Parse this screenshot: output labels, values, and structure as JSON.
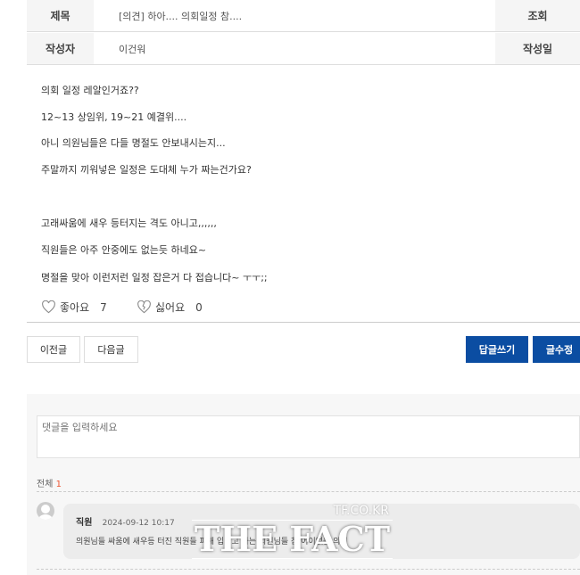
{
  "post": {
    "title_label": "제목",
    "title": "[의견] 하아.... 의회일정 참....",
    "views_label": "조회",
    "author_label": "작성자",
    "author": "이건워",
    "date_label": "작성일",
    "body": [
      "의회 일정 레알인거죠??",
      "12~13 상임위, 19~21 예결위....",
      "아니 의원님들은 다들 명절도 안보내시는지...",
      "주말까지 끼워넣은 일정은 도대체 누가 짜는건가요?",
      "고래싸움에 새우 등터지는 격도 아니고,,,,,,",
      "직원들은 아주 안중에도 없는듯 하네요~",
      "명절을 맞아 이런저런 일정 잡은거 다 접습니다~ ㅜㅜ;;"
    ],
    "like_label": "좋아요",
    "like_count": "7",
    "dislike_label": "싫어요",
    "dislike_count": "0"
  },
  "nav": {
    "prev": "이전글",
    "next": "다음글",
    "reply": "답글쓰기",
    "edit": "글수정",
    "accent": "#0b4da2"
  },
  "comments": {
    "placeholder": "댓글을 입력하세요",
    "total_label": "전체",
    "total_count": "1",
    "items": [
      {
        "author": "직원",
        "date": "2024-09-12 10:17",
        "text": "의원님들 싸움에 새우등 터진 직원들 피해 입히고 하는 의원님들 참 어이없는 의회"
      }
    ]
  },
  "watermark": {
    "top": "TF.CO.KR",
    "main": "THE FACT"
  }
}
